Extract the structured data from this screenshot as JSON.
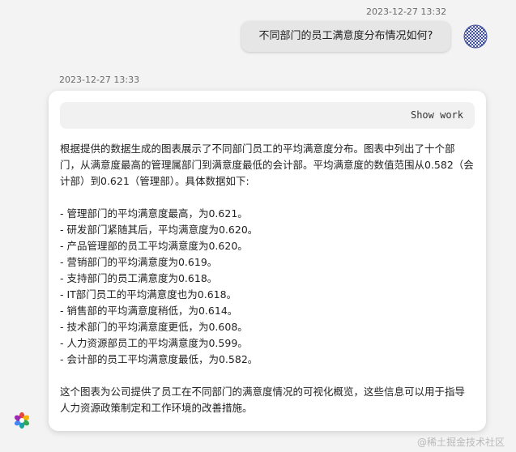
{
  "user_message": {
    "timestamp": "2023-12-27 13:32",
    "text": "不同部门的员工满意度分布情况如何?"
  },
  "bot_message": {
    "timestamp": "2023-12-27 13:33",
    "show_work_label": "Show work",
    "intro": "根据提供的数据生成的图表展示了不同部门员工的平均满意度分布。图表中列出了十个部门，从满意度最高的管理属部门到满意度最低的会计部。平均满意度的数值范围从0.582（会计部）到0.621（管理部）。具体数据如下:",
    "items": [
      "- 管理部门的平均满意度最高，为0.621。",
      "- 研发部门紧随其后，平均满意度为0.620。",
      "- 产品管理部的员工平均满意度为0.620。",
      "- 营销部门的平均满意度为0.619。",
      "- 支持部门的员工满意度为0.618。",
      "- IT部门员工的平均满意度也为0.618。",
      "- 销售部的平均满意度稍低，为0.614。",
      "- 技术部门的平均满意度更低，为0.608。",
      "- 人力资源部员工的平均满意度为0.599。",
      "- 会计部的员工平均满意度最低，为0.582。"
    ],
    "conclusion": "这个图表为公司提供了员工在不同部门的满意度情况的可视化概览，这些信息可以用于指导人力资源政策制定和工作环境的改善措施。"
  },
  "watermark": "@稀土掘金技术社区",
  "icons": {
    "user_avatar": "user-avatar-icon",
    "bot_logo": "bot-logo-icon"
  },
  "colors": {
    "page_background": "#f3f3f3",
    "user_bubble": "#e6e6e6",
    "card_background": "#ffffff",
    "show_work_background": "#f1f1f1"
  }
}
